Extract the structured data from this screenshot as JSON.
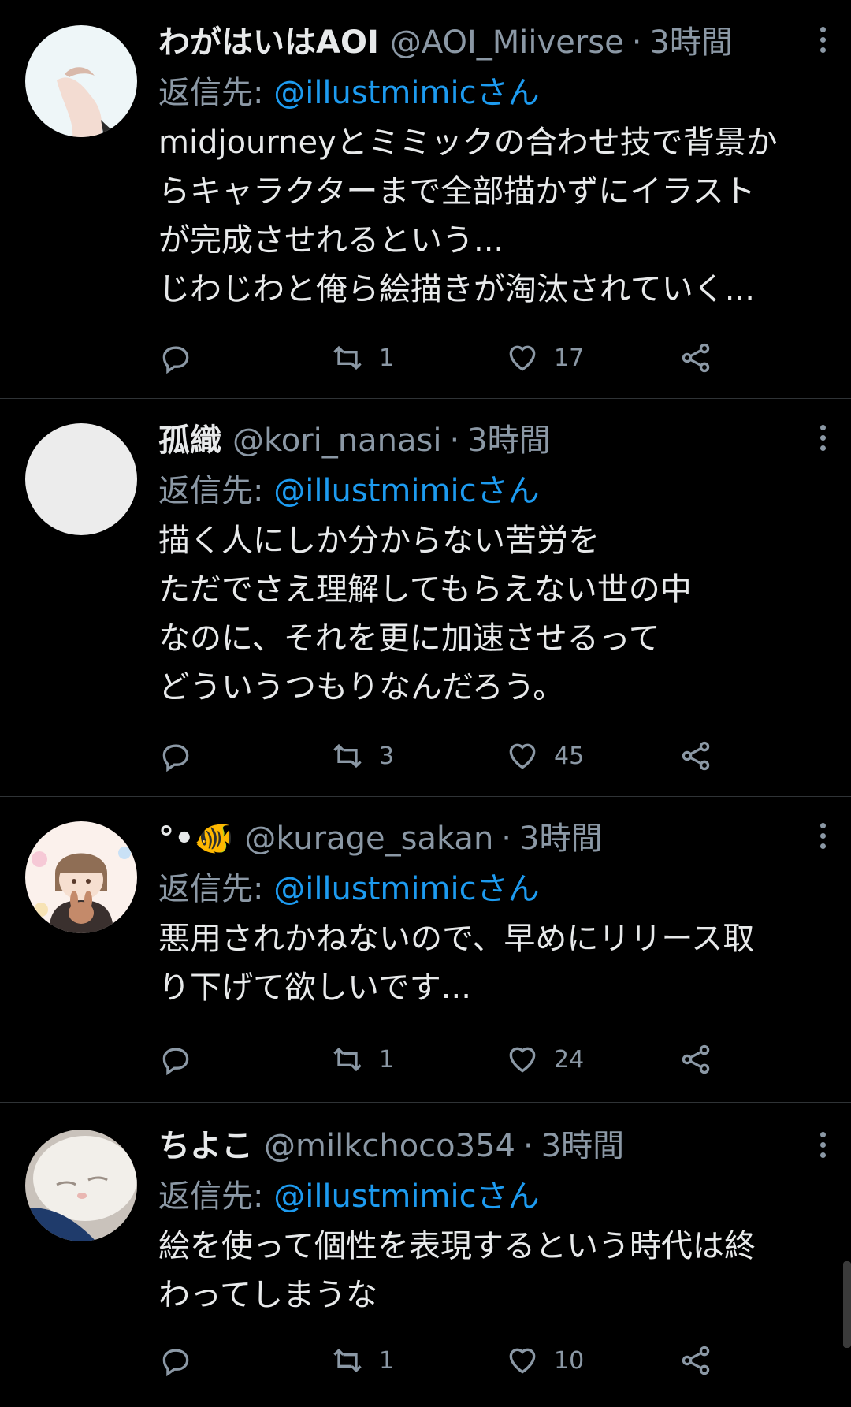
{
  "tweets": [
    {
      "name": "わがはいはAOI",
      "handle": "@AOI_Miiverse",
      "time": "3時間",
      "reply_prefix": "返信先:",
      "reply_to": "@illustmimicさん",
      "body": "midjourneyとミミックの合わせ技で背景か\nらキャラクターまで全部描かずにイラスト\nが完成させれるという...\nじわじわと俺ら絵描きが淘汰されていく...",
      "replies": "",
      "retweets": "1",
      "likes": "17"
    },
    {
      "name": "孤織",
      "handle": "@kori_nanasi",
      "time": "3時間",
      "reply_prefix": "返信先:",
      "reply_to": "@illustmimicさん",
      "body": "描く人にしか分からない苦労を\nただでさえ理解してもらえない世の中\nなのに、それを更に加速させるって\nどういうつもりなんだろう。",
      "replies": "",
      "retweets": "3",
      "likes": "45"
    },
    {
      "name": "°•🐠",
      "handle": "@kurage_sakan",
      "time": "3時間",
      "reply_prefix": "返信先:",
      "reply_to": "@illustmimicさん",
      "body": "悪用されかねないので、早めにリリース取\nり下げて欲しいです...",
      "replies": "",
      "retweets": "1",
      "likes": "24"
    },
    {
      "name": "ちよこ",
      "handle": "@milkchoco354",
      "time": "3時間",
      "reply_prefix": "返信先:",
      "reply_to": "@illustmimicさん",
      "body": "絵を使って個性を表現するという時代は終\nわってしまうな",
      "replies": "",
      "retweets": "1",
      "likes": "10"
    }
  ],
  "icons": {
    "reply": "reply-icon",
    "retweet": "retweet-icon",
    "like": "heart-icon",
    "share": "share-icon",
    "more": "more-icon"
  },
  "colors": {
    "background": "#000000",
    "text": "#e7e9ea",
    "secondary": "#8b98a5",
    "link": "#1d9bf0",
    "divider": "#2f3336"
  }
}
